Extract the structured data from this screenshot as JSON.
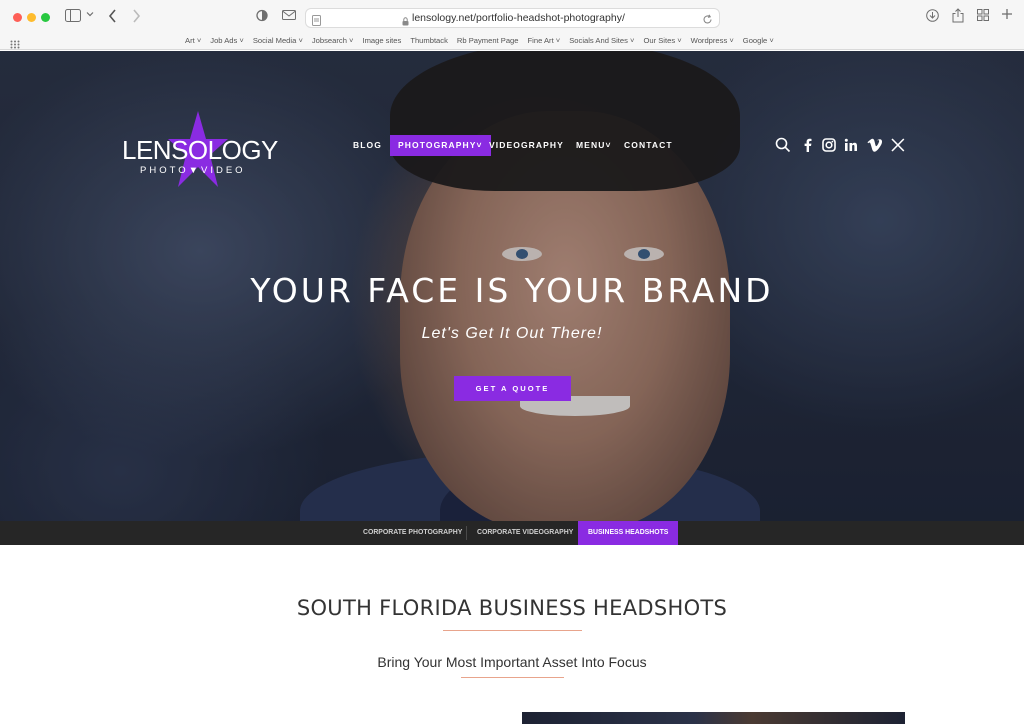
{
  "browser": {
    "url": "lensology.net/portfolio-headshot-photography/",
    "bookmarks": [
      "Art",
      "Job Ads",
      "Social Media",
      "Jobsearch",
      "Image sites",
      "Thumbtack",
      "Rb Payment Page",
      "Fine Art",
      "Socials And Sites",
      "Our Sites",
      "Wordpress",
      "Google"
    ]
  },
  "site": {
    "logo_word": "LENSOLOGY",
    "logo_sub": "PHOTO▼VIDEO",
    "nav": {
      "blog": "BLOG",
      "photography": "PHOTOGRAPHY",
      "videography": "VIDEOGRAPHY",
      "menu": "MENU",
      "contact": "CONTACT"
    },
    "social_icons": [
      "search-icon",
      "facebook-icon",
      "instagram-icon",
      "linkedin-icon",
      "vimeo-icon",
      "x-icon"
    ]
  },
  "hero": {
    "title": "YOUR FACE IS YOUR BRAND",
    "subtitle": "Let's Get It Out There!",
    "cta": "GET A QUOTE"
  },
  "subnav": {
    "corporate_photography": "CORPORATE PHOTOGRAPHY",
    "corporate_videography": "CORPORATE VIDEOGRAPHY",
    "business_headshots": "BUSINESS HEADSHOTS"
  },
  "content": {
    "title": "SOUTH FLORIDA BUSINESS HEADSHOTS",
    "subtitle": "Bring Your Most Important Asset Into Focus"
  },
  "colors": {
    "accent": "#8a2be2",
    "underline": "#e8a48c",
    "subnav_bg": "#262626"
  }
}
